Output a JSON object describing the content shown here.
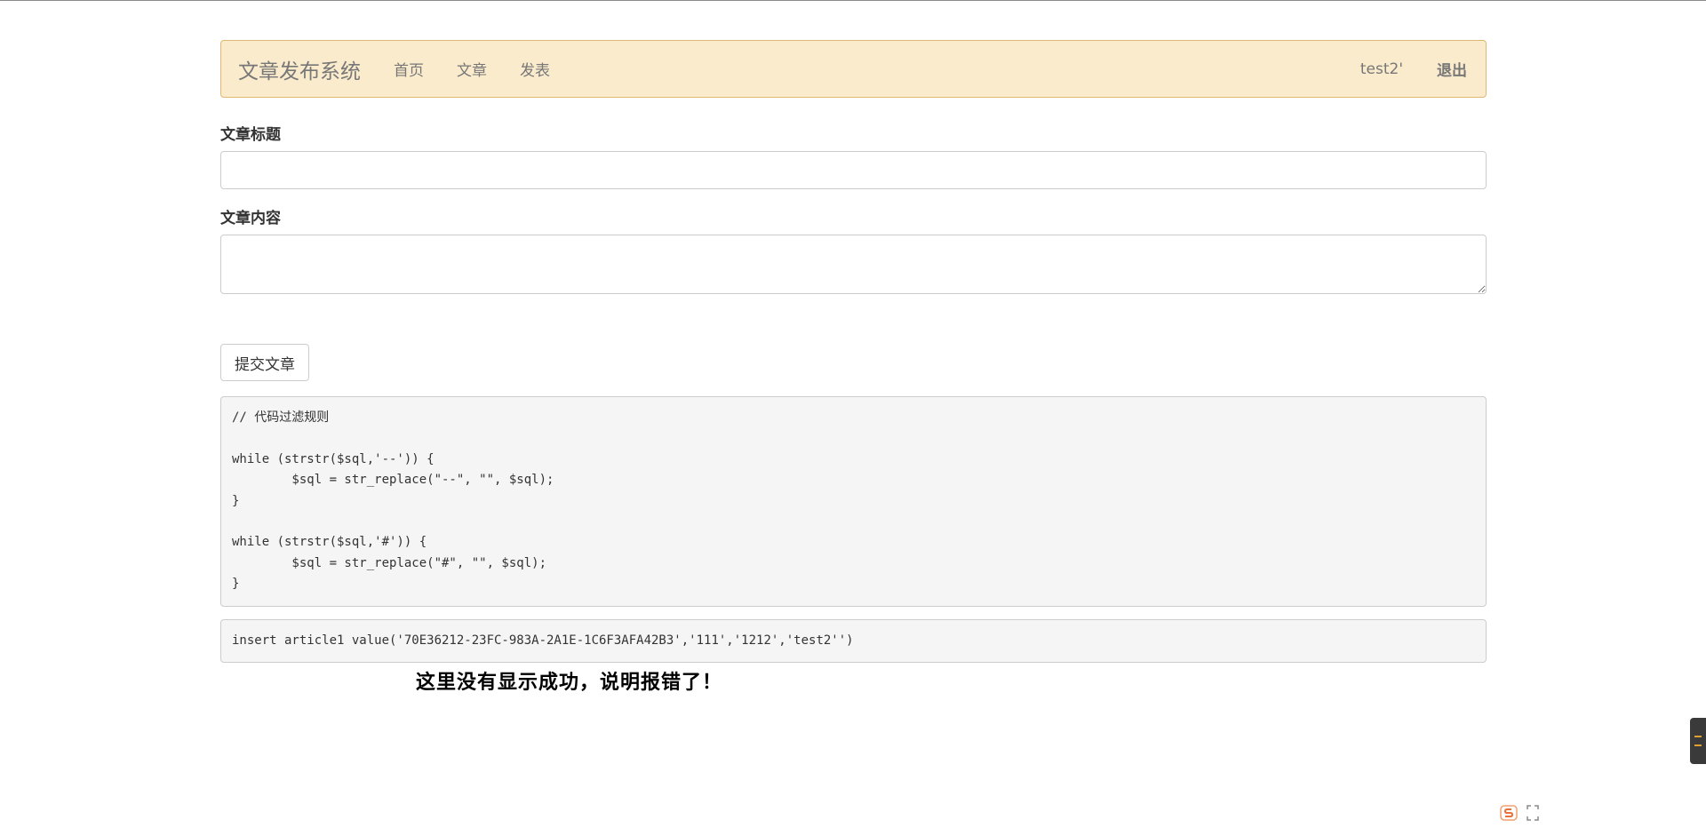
{
  "navbar": {
    "brand": "文章发布系统",
    "links": [
      "首页",
      "文章",
      "发表"
    ],
    "username": "test2'",
    "logout": "退出",
    "bg_color": "#faebcc",
    "border_color": "#e0b874"
  },
  "form": {
    "title_label": "文章标题",
    "title_value": "",
    "content_label": "文章内容",
    "content_value": "",
    "submit_label": "提交文章"
  },
  "code_filter": "// 代码过滤规则\n\nwhile (strstr($sql,'--')) {\n        $sql = str_replace(\"--\", \"\", $sql);\n}\n\nwhile (strstr($sql,'#')) {\n        $sql = str_replace(\"#\", \"\", $sql);\n}",
  "sql_statement": "insert article1 value('70E36212-23FC-983A-2A1E-1C6F3AFA42B3','111','1212','test2'')",
  "annotation": "这里没有显示成功，说明报错了！",
  "widgets": {
    "side_handle_icon": "scroll-handle-icon",
    "logo_icon": "s-logo-icon",
    "expand_icon": "expand-icon"
  }
}
